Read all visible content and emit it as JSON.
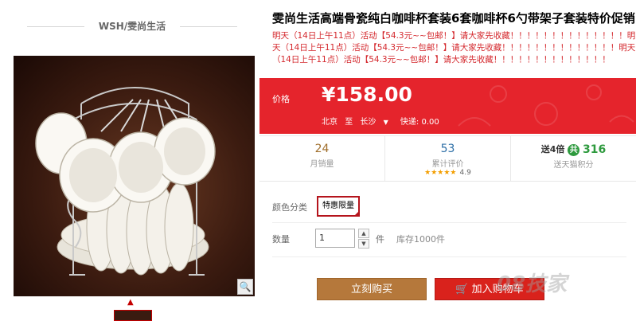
{
  "shop": {
    "name": "WSH/雯尚生活"
  },
  "product": {
    "title": "雯尚生活高端骨瓷纯白咖啡杯套装6套咖啡杯6勺带架子套装特价促销",
    "subtitle": "明天（14日上午11点）活动【54.3元~~包邮！】请大家先收藏！！！！！！！！！！！！！！明天（14日上午11点）活动【54.3元~~包邮！】请大家先收藏！！！！！！！！！！！！！！明天（14日上午11点）活动【54.3元~~包邮！】请大家先收藏！！！！！！！！！！！！！！"
  },
  "price": {
    "label": "价格",
    "value": "¥158.00",
    "shipping": {
      "from": "北京",
      "to_label": "至",
      "to": "长沙",
      "express": "快递: 0.00"
    }
  },
  "stats": {
    "monthly_sales": {
      "value": "24",
      "label": "月销量"
    },
    "reviews": {
      "value": "53",
      "label": "累计评价",
      "stars": "★★★★★",
      "score": "4.9"
    },
    "points": {
      "prefix": "送4倍",
      "badge": "共",
      "value": "316",
      "label": "送天猫积分"
    }
  },
  "options": {
    "color_label": "颜色分类",
    "selected_variant": "特惠限量",
    "qty_label": "数量",
    "qty_value": "1",
    "qty_unit": "件",
    "stock": "库存1000件"
  },
  "actions": {
    "buy_now": "立刻购买",
    "add_cart": "加入购物车"
  },
  "watermark": "08技家",
  "colors": {
    "price_bg": "#e5242c",
    "buy_btn": "#b5783b",
    "cart_btn": "#d9221c",
    "accent": "#b5141c"
  }
}
